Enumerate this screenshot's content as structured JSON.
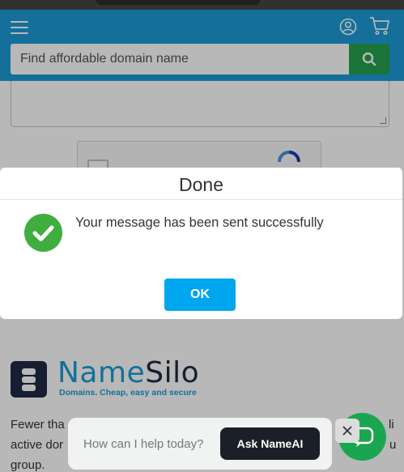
{
  "header": {
    "search_placeholder": "Find affordable domain name"
  },
  "brand": {
    "name_dark": "Name",
    "name_light": "Silo",
    "tagline": "Domains. Cheap, easy and secure"
  },
  "content": {
    "paragraph_lines": [
      "Fewer tha",
      "active dor",
      "group."
    ],
    "paragraph_right_fragments": [
      "li",
      "u"
    ]
  },
  "modal": {
    "title": "Done",
    "message": "Your message has been sent successfully",
    "ok_label": "OK"
  },
  "chat": {
    "prompt": "How can I help today?",
    "ask_label": "Ask NameAI"
  },
  "colors": {
    "header": "#1d9bd6",
    "search_button": "#25a04d",
    "ok_button": "#00a7ee",
    "success": "#3fae3f",
    "chat_fab": "#1aa650"
  },
  "icons": [
    "menu-icon",
    "user-icon",
    "cart-icon",
    "search-icon",
    "check-circle-icon",
    "close-icon",
    "chat-icon",
    "recaptcha-icon"
  ]
}
